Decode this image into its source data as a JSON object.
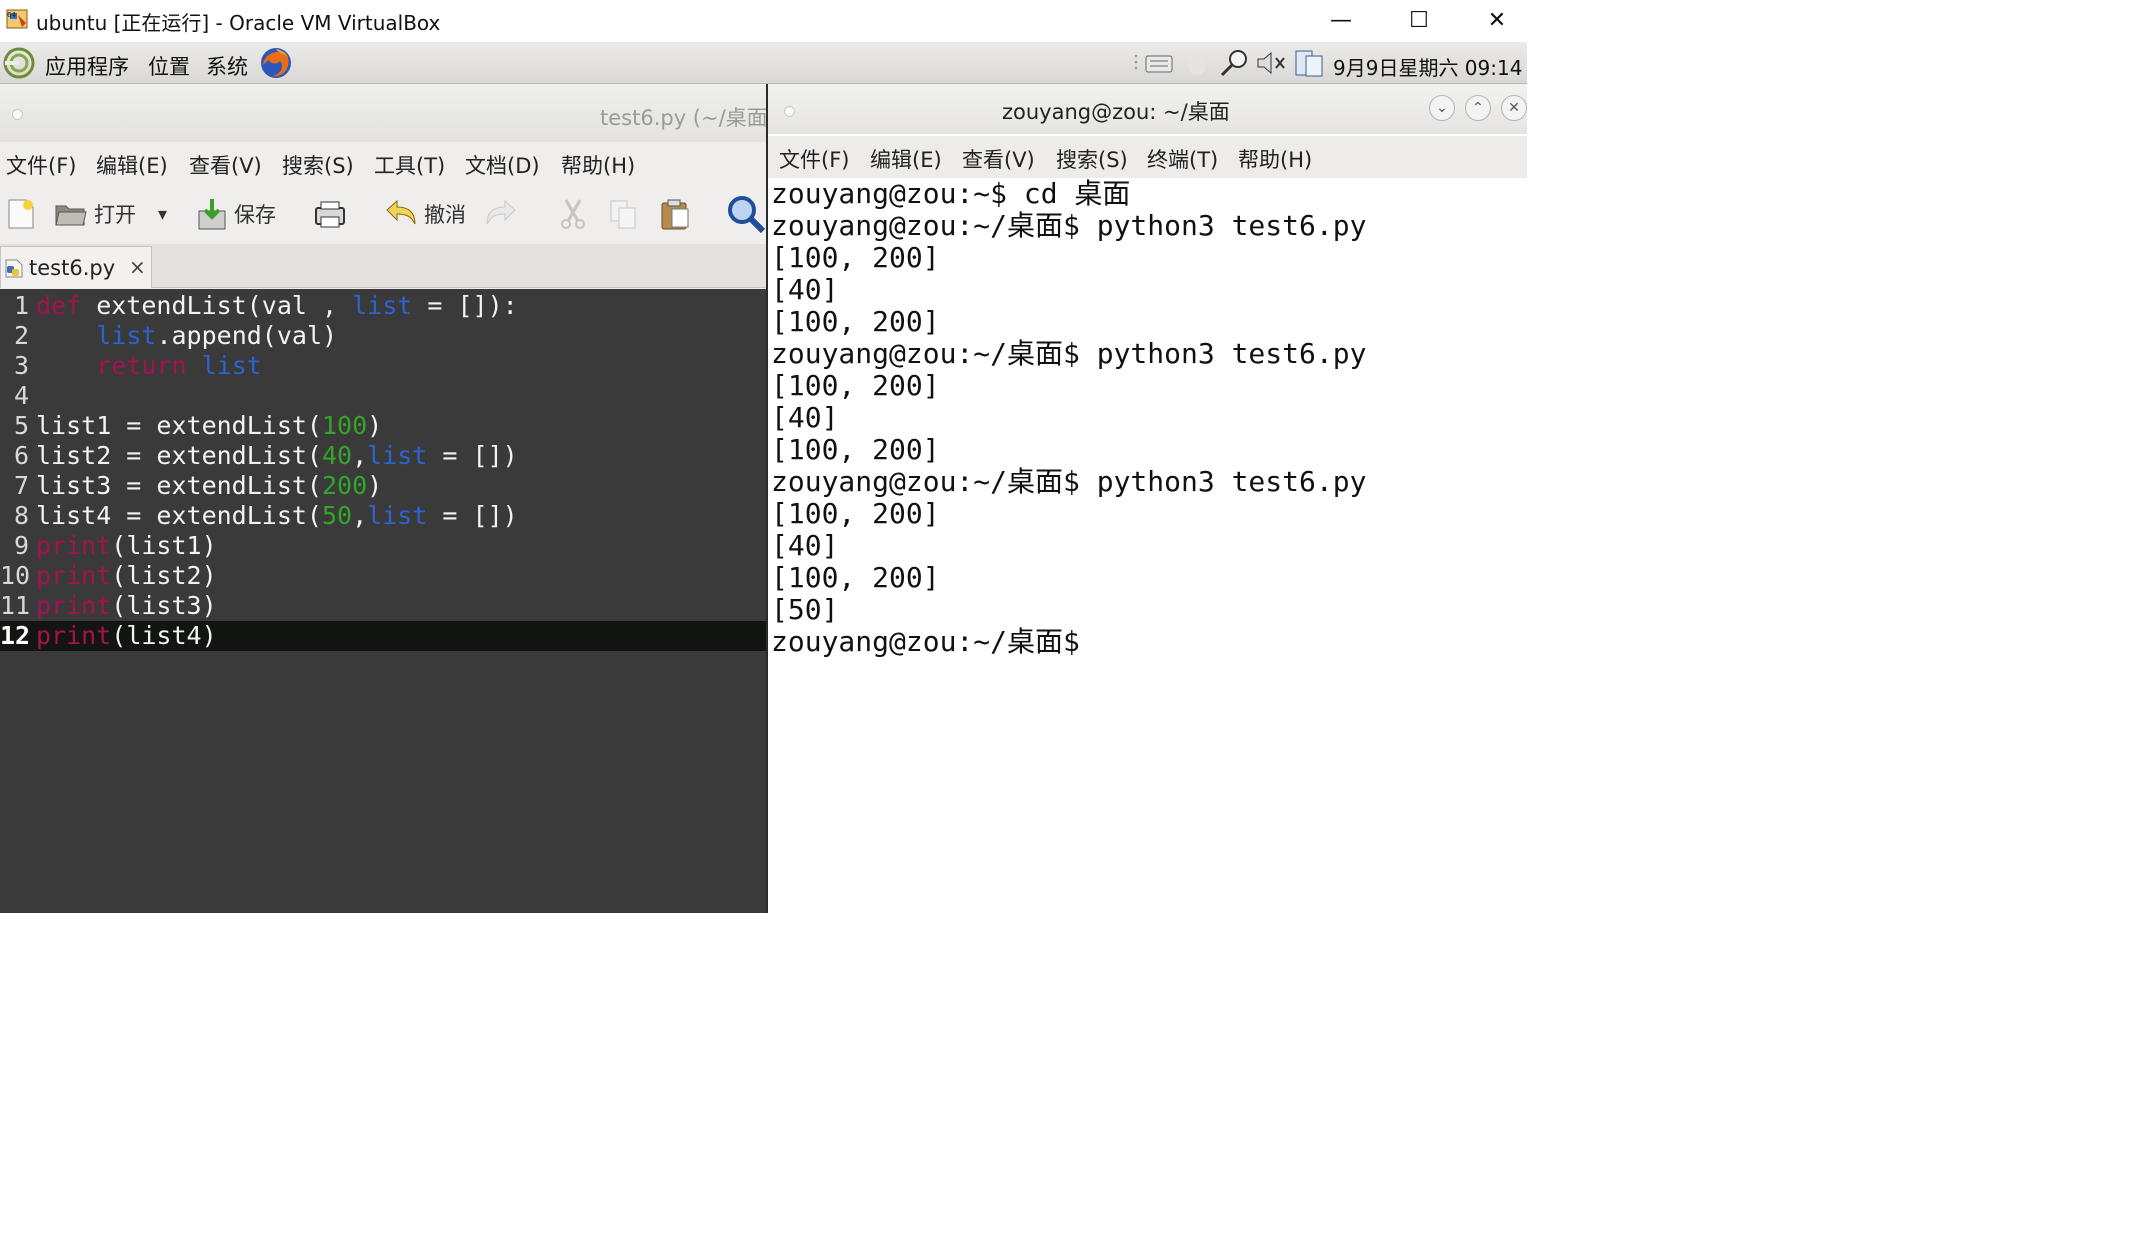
{
  "host_window": {
    "title": "ubuntu [正在运行] - Oracle VM VirtualBox",
    "minimize": "—",
    "maximize": "☐",
    "close": "✕"
  },
  "top_panel": {
    "menus": [
      "应用程序",
      "位置",
      "系统"
    ],
    "clock": "9月9日星期六 09:14"
  },
  "editor": {
    "title": "test6.py (~/桌面",
    "menus": [
      "文件(F)",
      "编辑(E)",
      "查看(V)",
      "搜索(S)",
      "工具(T)",
      "文档(D)",
      "帮助(H)"
    ],
    "toolbar": {
      "open": "打开",
      "open_dropdown": "▾",
      "save": "保存",
      "undo": "撤消"
    },
    "tab": {
      "label": "test6.py",
      "close": "×"
    },
    "current_line": 12,
    "lines": [
      {
        "n": "1",
        "tokens": [
          {
            "t": "def",
            "c": "kw"
          },
          {
            "t": " extendList(val , "
          },
          {
            "t": "list",
            "c": "bi"
          },
          {
            "t": " = []):"
          }
        ]
      },
      {
        "n": "2",
        "tokens": [
          {
            "t": "    "
          },
          {
            "t": "list",
            "c": "bi"
          },
          {
            "t": ".append(val)"
          }
        ]
      },
      {
        "n": "3",
        "tokens": [
          {
            "t": "    "
          },
          {
            "t": "return",
            "c": "kw"
          },
          {
            "t": " "
          },
          {
            "t": "list",
            "c": "bi"
          }
        ]
      },
      {
        "n": "4",
        "tokens": []
      },
      {
        "n": "5",
        "tokens": [
          {
            "t": "list1 = extendList("
          },
          {
            "t": "100",
            "c": "num"
          },
          {
            "t": ")"
          }
        ]
      },
      {
        "n": "6",
        "tokens": [
          {
            "t": "list2 = extendList("
          },
          {
            "t": "40",
            "c": "num"
          },
          {
            "t": ","
          },
          {
            "t": "list",
            "c": "bi"
          },
          {
            "t": " = [])"
          }
        ]
      },
      {
        "n": "7",
        "tokens": [
          {
            "t": "list3 = extendList("
          },
          {
            "t": "200",
            "c": "num"
          },
          {
            "t": ")"
          }
        ]
      },
      {
        "n": "8",
        "tokens": [
          {
            "t": "list4 = extendList("
          },
          {
            "t": "50",
            "c": "num"
          },
          {
            "t": ","
          },
          {
            "t": "list",
            "c": "bi"
          },
          {
            "t": " = [])"
          }
        ]
      },
      {
        "n": "9",
        "tokens": [
          {
            "t": "print",
            "c": "kw"
          },
          {
            "t": "(list1)"
          }
        ]
      },
      {
        "n": "10",
        "tokens": [
          {
            "t": "print",
            "c": "kw"
          },
          {
            "t": "(list2)"
          }
        ]
      },
      {
        "n": "11",
        "tokens": [
          {
            "t": "print",
            "c": "kw"
          },
          {
            "t": "(list3)"
          }
        ]
      },
      {
        "n": "12",
        "tokens": [
          {
            "t": "print",
            "c": "kw"
          },
          {
            "t": "(list4)"
          }
        ]
      }
    ]
  },
  "terminal": {
    "title": "zouyang@zou: ~/桌面",
    "menus": [
      "文件(F)",
      "编辑(E)",
      "查看(V)",
      "搜索(S)",
      "终端(T)",
      "帮助(H)"
    ],
    "buttons": {
      "minimize": "⌄",
      "maximize": "⌃",
      "close": "✕"
    },
    "lines": [
      "zouyang@zou:~$ cd 桌面",
      "zouyang@zou:~/桌面$ python3 test6.py",
      "[100, 200]",
      "[40]",
      "[100, 200]",
      "zouyang@zou:~/桌面$ python3 test6.py",
      "[100, 200]",
      "[40]",
      "[100, 200]",
      "zouyang@zou:~/桌面$ python3 test6.py",
      "[100, 200]",
      "[40]",
      "[100, 200]",
      "[50]",
      "zouyang@zou:~/桌面$"
    ]
  },
  "colors": {
    "keyword": "#a5124f",
    "builtin": "#2d63d0",
    "number": "#33a52a",
    "editor_bg": "#3a3a3a",
    "current_line_bg": "#121512"
  }
}
